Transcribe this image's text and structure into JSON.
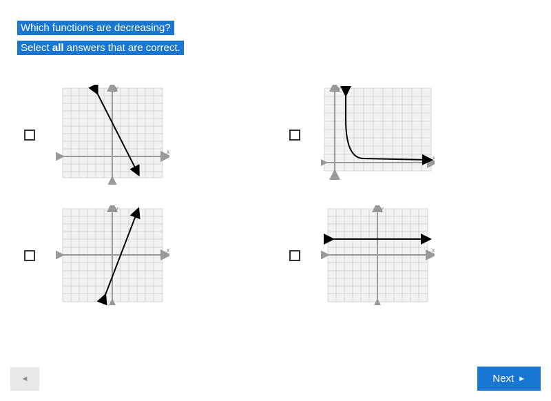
{
  "question": {
    "line1": "Which functions are decreasing?",
    "line2_prefix": "Select ",
    "line2_bold": "all",
    "line2_suffix": " answers that are correct."
  },
  "axis": {
    "x": "x",
    "y": "y"
  },
  "buttons": {
    "prev": "◄",
    "next": "Next",
    "next_icon": "►"
  },
  "chart_data": [
    {
      "type": "line",
      "title": "Option A",
      "description": "decreasing linear",
      "xlabel": "x",
      "ylabel": "y",
      "xlim": [
        -6,
        6
      ],
      "ylim": [
        -3,
        9
      ],
      "x": [
        -2,
        3
      ],
      "y": [
        9,
        -2
      ]
    },
    {
      "type": "line",
      "title": "Option B",
      "description": "decreasing reciprocal curve in quadrant I",
      "xlabel": "x",
      "ylabel": "y",
      "xlim": [
        -1,
        11
      ],
      "ylim": [
        -1,
        10
      ],
      "x": [
        1,
        1.2,
        1.5,
        2,
        3,
        5,
        10
      ],
      "y": [
        10,
        6,
        3,
        1.5,
        0.8,
        0.4,
        0.3
      ]
    },
    {
      "type": "line",
      "title": "Option C",
      "description": "increasing linear",
      "xlabel": "x",
      "ylabel": "y",
      "xlim": [
        -6,
        6
      ],
      "ylim": [
        -6,
        6
      ],
      "x": [
        -1,
        3
      ],
      "y": [
        -6,
        6
      ]
    },
    {
      "type": "line",
      "title": "Option D",
      "description": "horizontal constant",
      "xlabel": "x",
      "ylabel": "y",
      "xlim": [
        -6,
        6
      ],
      "ylim": [
        -6,
        6
      ],
      "x": [
        -6,
        6
      ],
      "y": [
        2,
        2
      ]
    }
  ]
}
